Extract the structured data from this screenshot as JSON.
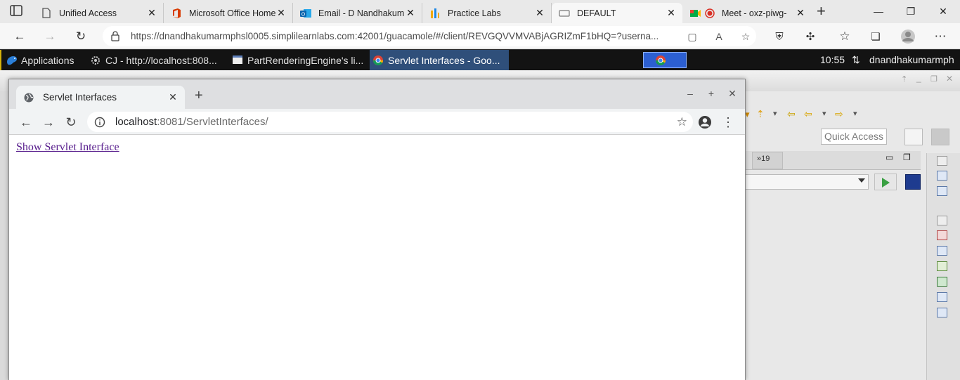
{
  "edge": {
    "tabs": [
      {
        "title": "Unified Access",
        "icon": "page-icon"
      },
      {
        "title": "Microsoft Office Home",
        "icon": "office-icon"
      },
      {
        "title": "Email - D Nandhakum",
        "icon": "outlook-icon"
      },
      {
        "title": "Practice Labs",
        "icon": "bar-chart-icon"
      },
      {
        "title": "DEFAULT",
        "icon": "blank-page-icon"
      },
      {
        "title": "Meet - oxz-piwg-",
        "icon": "meet-icon"
      }
    ],
    "url": "https://dnandhakumarmphsl0005.simplilearnlabs.com:42001/guacamole/#/client/REVGQVVMVABjAGRIZmF1bHQ=?userna..."
  },
  "panel": {
    "applications_label": "Applications",
    "apps": [
      {
        "title": "CJ - http://localhost:808..."
      },
      {
        "title": "PartRenderingEngine's li..."
      },
      {
        "title": "Servlet Interfaces - Goo..."
      }
    ],
    "clock": "10:55",
    "user": "dnandhakumarmph"
  },
  "eclipse": {
    "quick_access_placeholder": "Quick Access",
    "overflow_label": "»19"
  },
  "chrome": {
    "tab_title": "Servlet Interfaces",
    "address_host": "localhost",
    "address_path": ":8081/ServletInterfaces/",
    "link_text": "Show Servlet Interface"
  },
  "colors": {
    "edge_tabbar": "#e9e9e9",
    "panel_bg": "#131313",
    "panel_active": "#2f4f7a",
    "link_visited": "#551a8b"
  }
}
